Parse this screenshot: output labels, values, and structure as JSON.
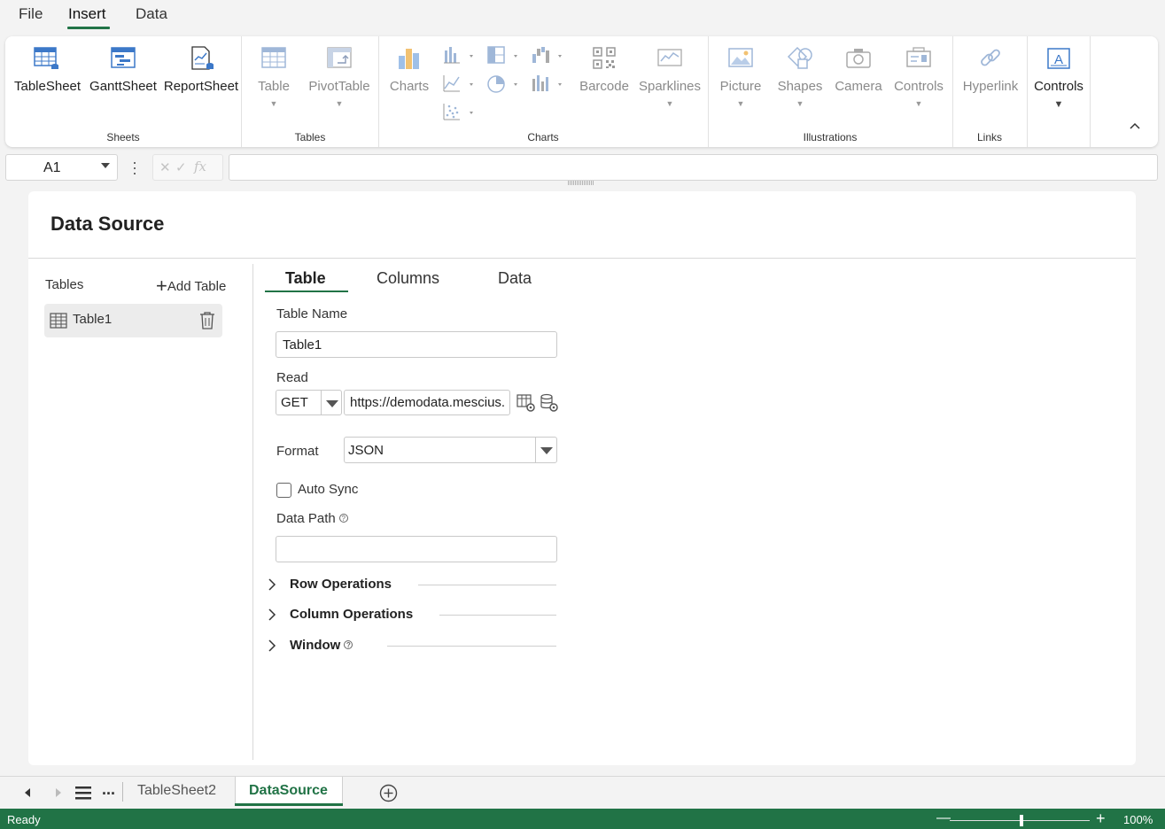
{
  "menu": {
    "items": [
      "File",
      "Insert",
      "Data"
    ],
    "active": "Insert"
  },
  "ribbon": {
    "groups": {
      "sheets": "Sheets",
      "tables": "Tables",
      "charts": "Charts",
      "illustrations": "Illustrations",
      "links": "Links"
    },
    "buttons": {
      "tablesheet": "TableSheet",
      "ganttsheet": "GanttSheet",
      "reportsheet": "ReportSheet",
      "table": "Table",
      "pivottable": "PivotTable",
      "charts": "Charts",
      "barcode": "Barcode",
      "sparklines": "Sparklines",
      "picture": "Picture",
      "shapes": "Shapes",
      "camera": "Camera",
      "controls_illus": "Controls",
      "hyperlink": "Hyperlink",
      "controls": "Controls"
    },
    "collapse_icon": "chevron-up-icon"
  },
  "formula_bar": {
    "namebox": "A1",
    "fx": "fx",
    "formula": ""
  },
  "panel": {
    "title": "Data Source",
    "tables_label": "Tables",
    "add_table": "Add Table",
    "table_items": [
      "Table1"
    ],
    "tabs": [
      "Table",
      "Columns",
      "Data"
    ],
    "active_tab": "Table",
    "form": {
      "table_name_label": "Table Name",
      "table_name_value": "Table1",
      "read_label": "Read",
      "read_method": "GET",
      "read_url": "https://demodata.mescius.",
      "format_label": "Format",
      "format_value": "JSON",
      "auto_sync_label": "Auto Sync",
      "auto_sync_checked": false,
      "data_path_label": "Data Path",
      "data_path_value": "",
      "help_glyph": "?"
    },
    "sections": [
      "Row Operations",
      "Column Operations",
      "Window"
    ]
  },
  "sheets": {
    "tabs": [
      "TableSheet2",
      "DataSource"
    ],
    "active": "DataSource",
    "more": "..."
  },
  "status": {
    "text": "Ready",
    "zoom": "100%",
    "zoom_minus": "—",
    "zoom_plus": "+",
    "zoom_level": 100
  },
  "colors": {
    "accent": "#217346",
    "icon_blue": "#3c78c8",
    "disabled": "#8a8a8a"
  }
}
